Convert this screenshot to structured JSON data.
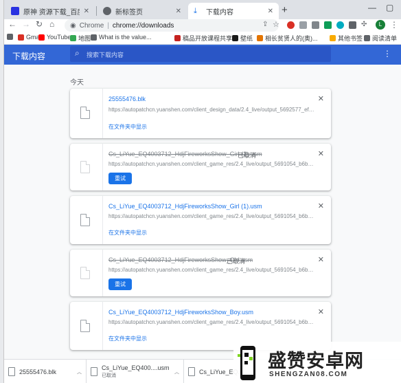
{
  "tabs": [
    {
      "title": "原神 资源下载_百度搜索",
      "active": false
    },
    {
      "title": "新标签页",
      "active": false
    },
    {
      "title": "下载内容",
      "active": true
    }
  ],
  "toolbar": {
    "omnibox_scheme": "Chrome",
    "omnibox_url": "chrome://downloads",
    "avatar_letter": "L"
  },
  "bookmarks": [
    {
      "label": "Gmail",
      "color": "#d93025"
    },
    {
      "label": "YouTube",
      "color": "#ff0000"
    },
    {
      "label": "地图",
      "color": "#34a853"
    },
    {
      "label": "What is the value...",
      "color": "#5f6368"
    },
    {
      "label": "稿品开放课程共享...",
      "color": "#c5221f"
    },
    {
      "label": "壁纸",
      "color": "#1a1a1a"
    },
    {
      "label": "相长贫贤人的(奥)...",
      "color": "#e37400"
    },
    {
      "label": "其他书签",
      "color": "#f9ab00"
    },
    {
      "label": "阅读清单",
      "color": "#5f6368"
    }
  ],
  "downloads_page": {
    "title": "下载内容",
    "search_placeholder": "搜索下载内容",
    "date_heading": "今天",
    "items": [
      {
        "filename": "25555476.blk",
        "url": "https://autopatchcn.yuanshen.com/client_design_data/2.4_live/output_5692577_eff...",
        "status": "",
        "cancelled": false,
        "action": "在文件夹中显示"
      },
      {
        "filename": "Cs_LiYue_EQ4003712_HdjFireworksShow_Girl (2).usm",
        "url": "https://autopatchcn.yuanshen.com/client_game_res/2.4_live/output_5691054_b6bd...",
        "status": "已取消",
        "cancelled": true,
        "action": "重试"
      },
      {
        "filename": "Cs_LiYue_EQ4003712_HdjFireworksShow_Girl (1).usm",
        "url": "https://autopatchcn.yuanshen.com/client_game_res/2.4_live/output_5691054_b6bd...",
        "status": "",
        "cancelled": false,
        "action": "在文件夹中显示"
      },
      {
        "filename": "Cs_LiYue_EQ4003712_HdjFireworksShow_Girl.usm",
        "url": "https://autopatchcn.yuanshen.com/client_game_res/2.4_live/output_5691054_b6bd...",
        "status": "已取消",
        "cancelled": true,
        "action": "重试"
      },
      {
        "filename": "Cs_LiYue_EQ4003712_HdjFireworksShow_Boy.usm",
        "url": "https://autopatchcn.yuanshen.com/client_game_res/2.4_live/output_5691054_b6bd...",
        "status": "",
        "cancelled": false,
        "action": "在文件夹中显示"
      }
    ]
  },
  "shelf": [
    {
      "name": "25555476.blk",
      "status": ""
    },
    {
      "name": "Cs_LiYue_EQ400....usm",
      "status": "已取消"
    },
    {
      "name": "Cs_LiYue_EQ..."
    }
  ],
  "watermark": {
    "title": "盛赞安卓网",
    "subtitle": "SHENGZAN08.COM"
  },
  "colors": {
    "accent": "#3367d6",
    "link": "#1a73e8"
  }
}
